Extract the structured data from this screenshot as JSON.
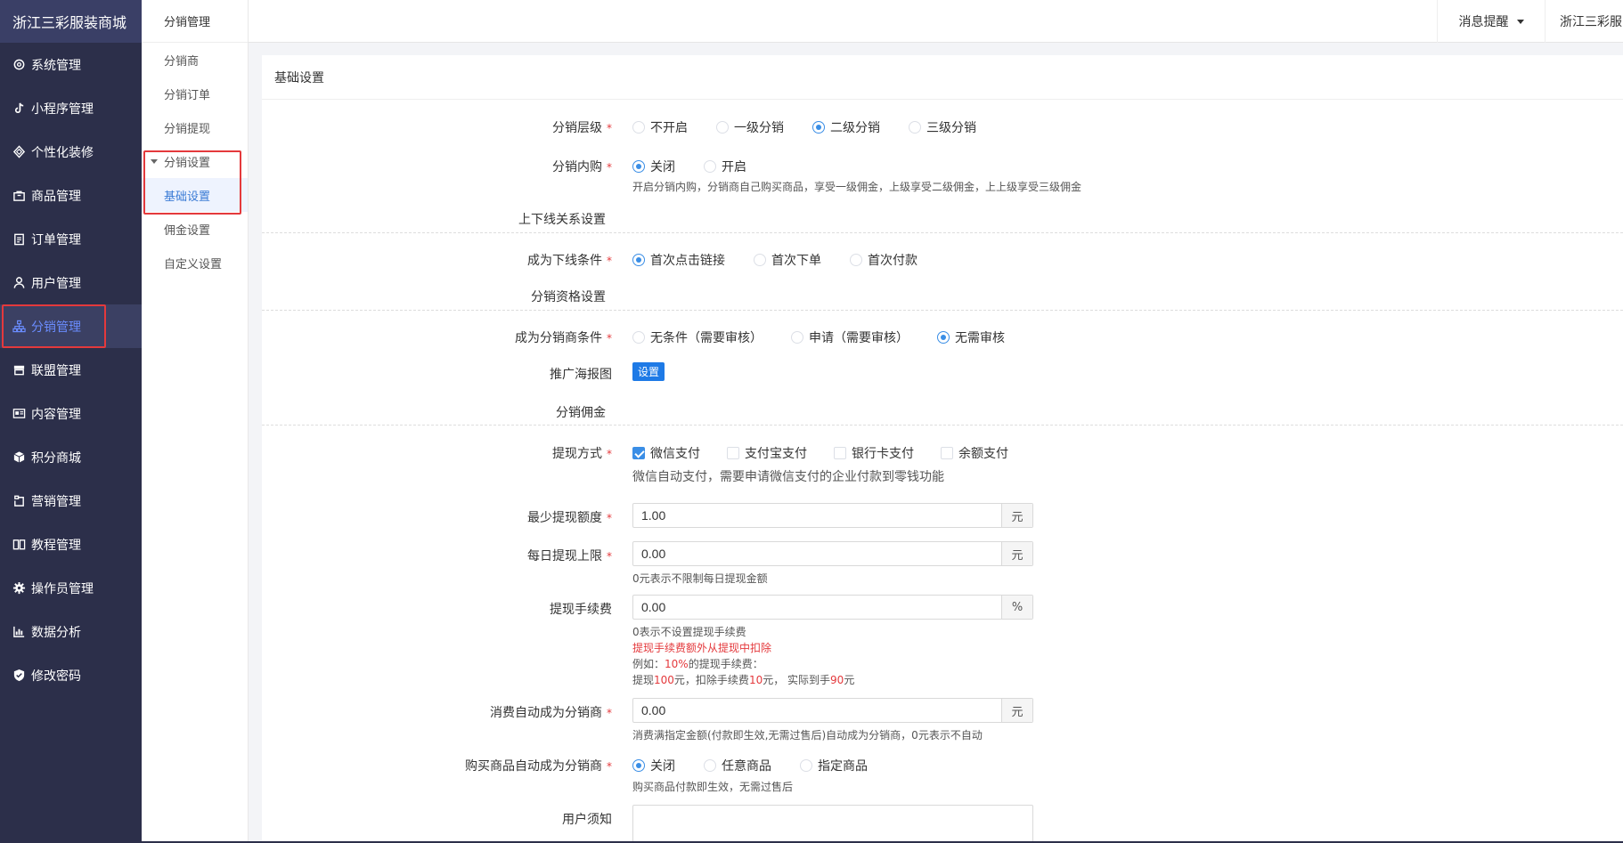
{
  "brand": "浙江三彩服装商城",
  "sidebar": {
    "items": [
      {
        "label": "系统管理",
        "icon": "gear-icon"
      },
      {
        "label": "小程序管理",
        "icon": "tiktok-icon"
      },
      {
        "label": "个性化装修",
        "icon": "diamond-icon"
      },
      {
        "label": "商品管理",
        "icon": "bag-icon"
      },
      {
        "label": "订单管理",
        "icon": "clipboard-icon"
      },
      {
        "label": "用户管理",
        "icon": "user-icon"
      },
      {
        "label": "分销管理",
        "icon": "sitemap-icon"
      },
      {
        "label": "联盟管理",
        "icon": "store-icon"
      },
      {
        "label": "内容管理",
        "icon": "newspaper-icon"
      },
      {
        "label": "积分商城",
        "icon": "cube-icon"
      },
      {
        "label": "营销管理",
        "icon": "coupon-icon"
      },
      {
        "label": "教程管理",
        "icon": "book-icon"
      },
      {
        "label": "操作员管理",
        "icon": "cog-icon"
      },
      {
        "label": "数据分析",
        "icon": "chart-icon"
      },
      {
        "label": "修改密码",
        "icon": "shield-icon"
      }
    ],
    "active_index": 6
  },
  "subnav": {
    "title": "分销管理",
    "items": [
      "分销商",
      "分销订单",
      "分销提现"
    ],
    "group": "分销设置",
    "group_items": [
      "基础设置",
      "佣金设置",
      "自定义设置"
    ]
  },
  "topbar": {
    "message": "消息提醒",
    "user": "浙江三彩服"
  },
  "card_title": "基础设置",
  "form": {
    "level": {
      "label": "分销层级",
      "options": [
        "不开启",
        "一级分销",
        "二级分销",
        "三级分销"
      ]
    },
    "self_buy": {
      "label": "分销内购",
      "options": [
        "关闭",
        "开启"
      ],
      "hint": "开启分销内购，分销商自己购买商品，享受一级佣金，上级享受二级佣金，上上级享受三级佣金"
    },
    "section_relation": "上下线关系设置",
    "downline": {
      "label": "成为下线条件",
      "options": [
        "首次点击链接",
        "首次下单",
        "首次付款"
      ]
    },
    "section_qualify": "分销资格设置",
    "become": {
      "label": "成为分销商条件",
      "options": [
        "无条件（需要审核）",
        "申请（需要审核）",
        "无需审核"
      ]
    },
    "poster": {
      "label": "推广海报图",
      "button": "设置"
    },
    "section_commission": "分销佣金",
    "withdraw": {
      "label": "提现方式",
      "options": [
        "微信支付",
        "支付宝支付",
        "银行卡支付",
        "余额支付"
      ],
      "hint": "微信自动支付，需要申请微信支付的企业付款到零钱功能"
    },
    "min_withdraw": {
      "label": "最少提现额度",
      "value": "1.00",
      "unit": "元"
    },
    "daily_limit": {
      "label": "每日提现上限",
      "value": "0.00",
      "unit": "元",
      "hint": "0元表示不限制每日提现金额"
    },
    "fee": {
      "label": "提现手续费",
      "value": "0.00",
      "unit": "%",
      "hint1": "0表示不设置提现手续费",
      "hint2": "提现手续费额外从提现中扣除",
      "hint3_a": "例如：",
      "hint3_b": "10%",
      "hint3_c": "的提现手续费：",
      "hint4_a": "提现",
      "hint4_b": "100",
      "hint4_c": "元，扣除手续费",
      "hint4_d": "10",
      "hint4_e": "元， 实际到手",
      "hint4_f": "90",
      "hint4_g": "元"
    },
    "auto_consume": {
      "label": "消费自动成为分销商",
      "value": "0.00",
      "unit": "元",
      "hint": "消费满指定金额(付款即生效,无需过售后)自动成为分销商，0元表示不自动"
    },
    "auto_buy": {
      "label": "购买商品自动成为分销商",
      "options": [
        "关闭",
        "任意商品",
        "指定商品"
      ],
      "hint": "购买商品付款即生效，无需过售后"
    },
    "notice": {
      "label": "用户须知",
      "value": ""
    }
  }
}
